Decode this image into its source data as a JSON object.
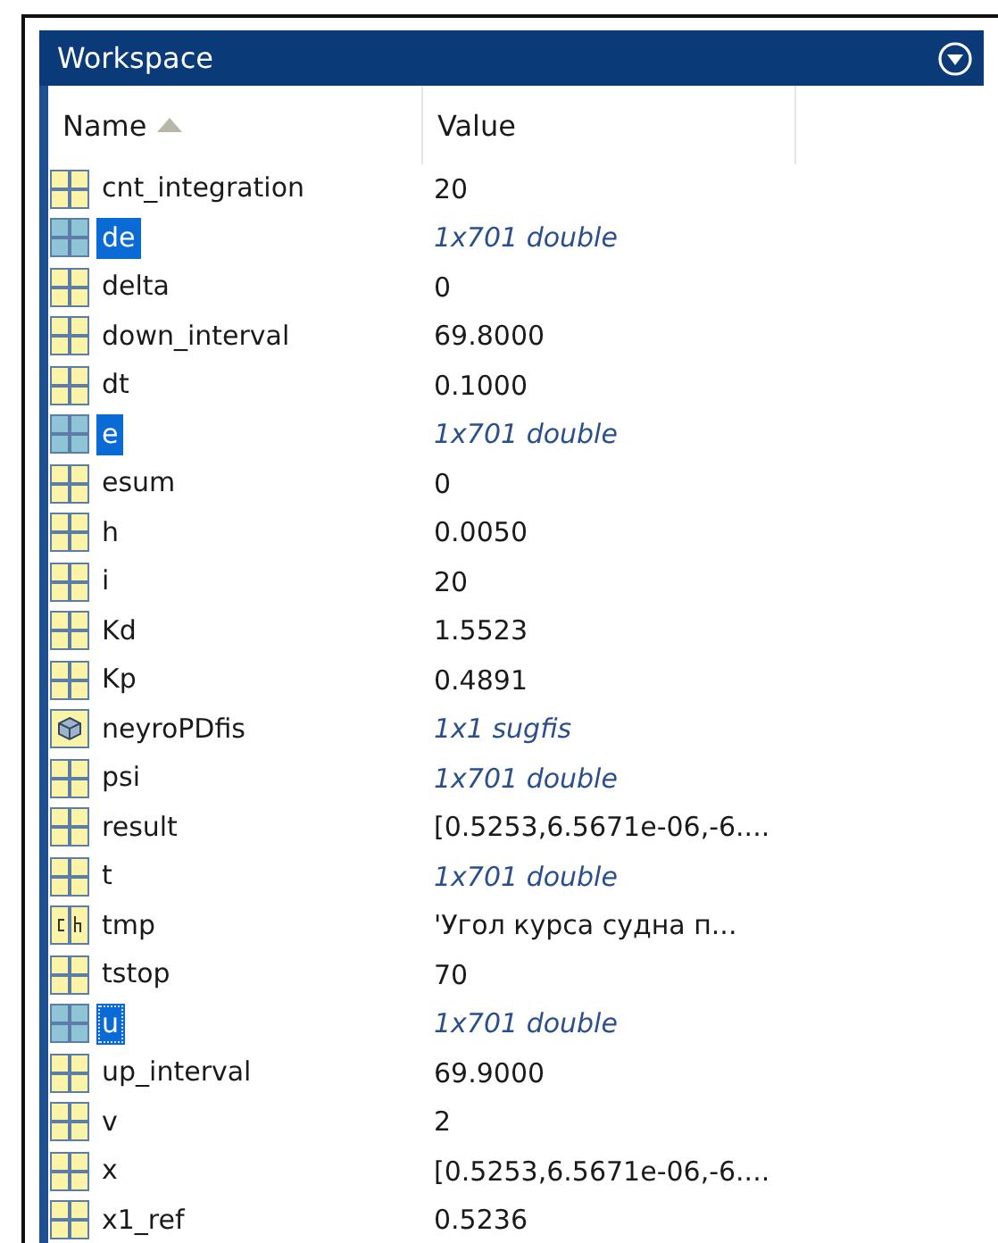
{
  "panel": {
    "title": "Workspace"
  },
  "columns": [
    {
      "label": "Name",
      "sorted": true
    },
    {
      "label": "Value",
      "sorted": false
    }
  ],
  "rows": [
    {
      "kind": "matrix",
      "name": "cnt_integration",
      "value": "20",
      "summary": false,
      "selected": false,
      "focused": false
    },
    {
      "kind": "matrix",
      "name": "de",
      "value": "1x701 double",
      "summary": true,
      "selected": true,
      "focused": false
    },
    {
      "kind": "matrix",
      "name": "delta",
      "value": "0",
      "summary": false,
      "selected": false,
      "focused": false
    },
    {
      "kind": "matrix",
      "name": "down_interval",
      "value": "69.8000",
      "summary": false,
      "selected": false,
      "focused": false
    },
    {
      "kind": "matrix",
      "name": "dt",
      "value": "0.1000",
      "summary": false,
      "selected": false,
      "focused": false
    },
    {
      "kind": "matrix",
      "name": "e",
      "value": "1x701 double",
      "summary": true,
      "selected": true,
      "focused": false
    },
    {
      "kind": "matrix",
      "name": "esum",
      "value": "0",
      "summary": false,
      "selected": false,
      "focused": false
    },
    {
      "kind": "matrix",
      "name": "h",
      "value": "0.0050",
      "summary": false,
      "selected": false,
      "focused": false
    },
    {
      "kind": "matrix",
      "name": "i",
      "value": "20",
      "summary": false,
      "selected": false,
      "focused": false
    },
    {
      "kind": "matrix",
      "name": "Kd",
      "value": "1.5523",
      "summary": false,
      "selected": false,
      "focused": false
    },
    {
      "kind": "matrix",
      "name": "Kp",
      "value": "0.4891",
      "summary": false,
      "selected": false,
      "focused": false
    },
    {
      "kind": "object",
      "name": "neyroPDfis",
      "value": "1x1 sugfis",
      "summary": true,
      "selected": false,
      "focused": false
    },
    {
      "kind": "matrix",
      "name": "psi",
      "value": "1x701 double",
      "summary": true,
      "selected": false,
      "focused": false
    },
    {
      "kind": "matrix",
      "name": "result",
      "value": "[0.5253,6.5671e-06,-6....",
      "summary": false,
      "selected": false,
      "focused": false
    },
    {
      "kind": "matrix",
      "name": "t",
      "value": "1x701 double",
      "summary": true,
      "selected": false,
      "focused": false
    },
    {
      "kind": "char",
      "name": "tmp",
      "value": "'Угол курса судна п...",
      "summary": false,
      "selected": false,
      "focused": false
    },
    {
      "kind": "matrix",
      "name": "tstop",
      "value": "70",
      "summary": false,
      "selected": false,
      "focused": false
    },
    {
      "kind": "matrix",
      "name": "u",
      "value": "1x701 double",
      "summary": true,
      "selected": true,
      "focused": true
    },
    {
      "kind": "matrix",
      "name": "up_interval",
      "value": "69.9000",
      "summary": false,
      "selected": false,
      "focused": false
    },
    {
      "kind": "matrix",
      "name": "v",
      "value": "2",
      "summary": false,
      "selected": false,
      "focused": false
    },
    {
      "kind": "matrix",
      "name": "x",
      "value": "[0.5253,6.5671e-06,-6....",
      "summary": false,
      "selected": false,
      "focused": false
    },
    {
      "kind": "matrix",
      "name": "x1_ref",
      "value": "0.5236",
      "summary": false,
      "selected": false,
      "focused": false
    }
  ]
}
